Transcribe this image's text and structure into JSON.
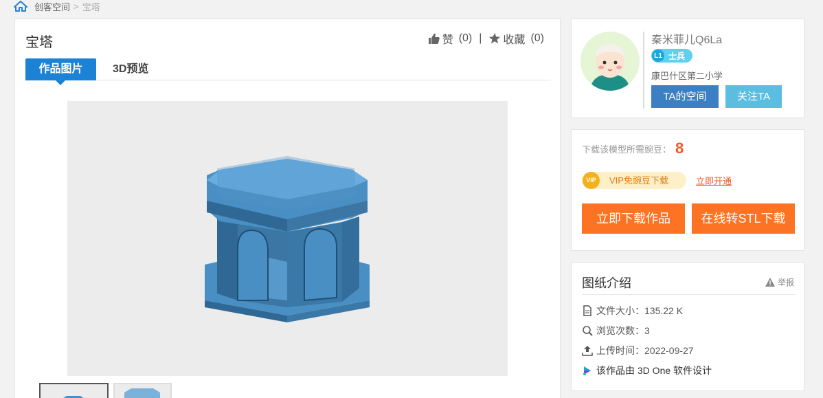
{
  "breadcrumb": {
    "section": "创客空间",
    "separator": ">",
    "current": "宝塔"
  },
  "work": {
    "title": "宝塔",
    "like_label": "赞",
    "like_count": "(0)",
    "stat_divider": "|",
    "fav_label": "收藏",
    "fav_count": "(0)"
  },
  "tabs": [
    {
      "label": "作品图片",
      "active": true
    },
    {
      "label": "3D预览",
      "active": false
    }
  ],
  "author": {
    "name": "秦米菲儿Q6La",
    "level_badge": "L1",
    "level_title": "士兵",
    "school": "康巴什区第二小学",
    "space_button": "TA的空间",
    "follow_button": "关注TA"
  },
  "download": {
    "need_label": "下载该模型所需豌豆：",
    "need_value": "8",
    "vip_icon_text": "VIP",
    "vip_label": "VIP免豌豆下载",
    "open_link": "立即开通",
    "download_button": "立即下载作品",
    "stl_button": "在线转STL下载"
  },
  "intro": {
    "title": "图纸介绍",
    "report": "举报",
    "file_size": "文件大小：135.22 K",
    "views": "浏览次数：3",
    "upload_time": "上传时间：2022-09-27",
    "software": "该作品由 3D One 软件设计"
  },
  "colors": {
    "primary_blue": "#1c82d6",
    "orange": "#fd7324",
    "accent_red": "#f05a28",
    "model_blue": "#4a8fc3"
  }
}
